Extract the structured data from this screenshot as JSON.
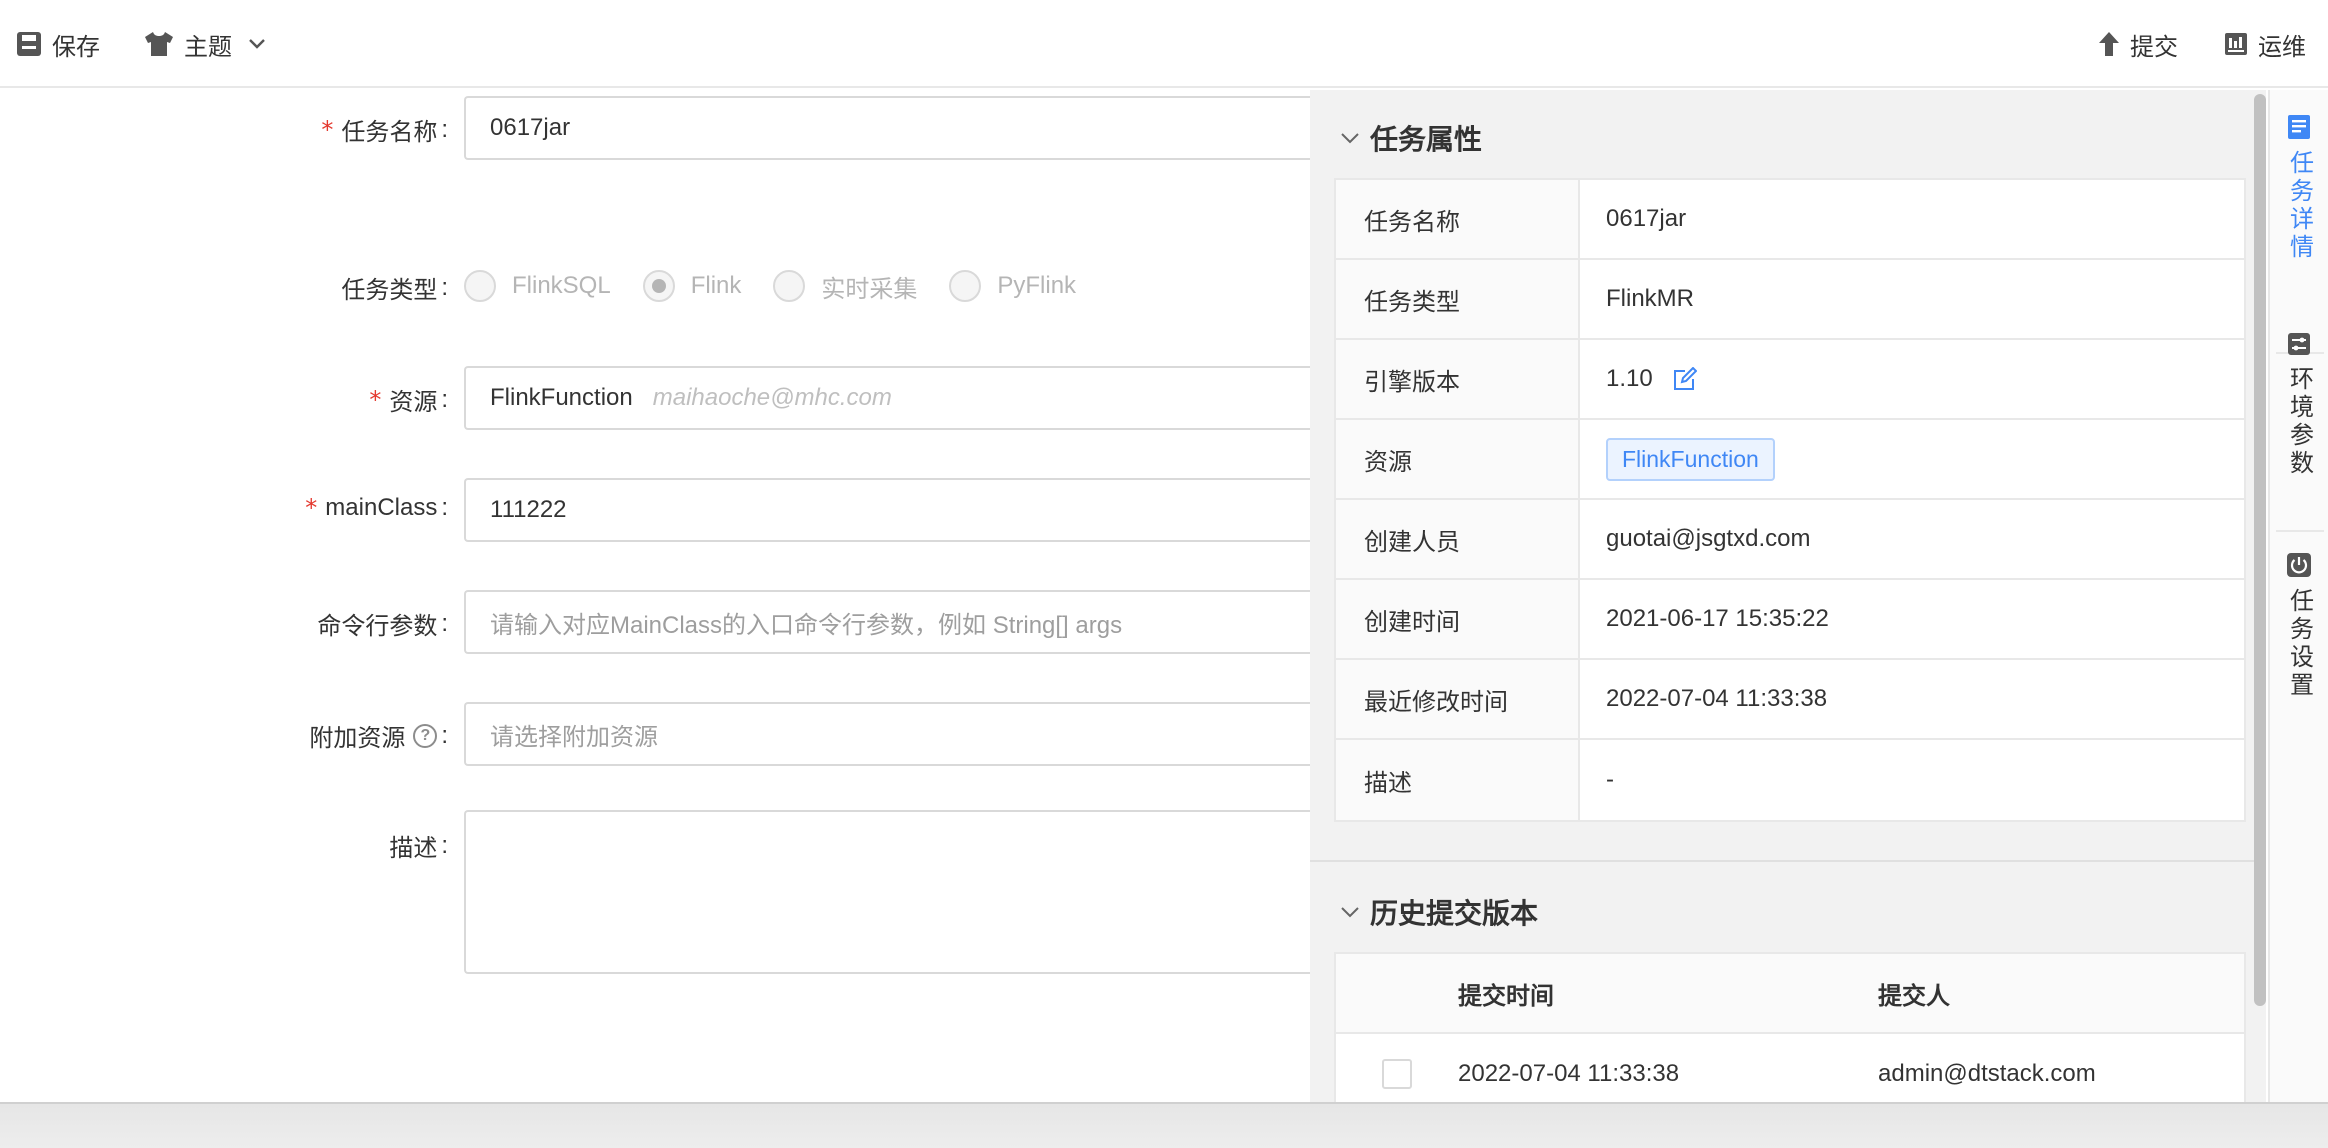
{
  "toolbar": {
    "save": "保存",
    "theme": "主题",
    "submit": "提交",
    "ops": "运维"
  },
  "form": {
    "task_name": {
      "label": "任务名称",
      "value": "0617jar"
    },
    "task_type": {
      "label": "任务类型",
      "options": [
        "FlinkSQL",
        "Flink",
        "实时采集",
        "PyFlink"
      ],
      "selected": "Flink"
    },
    "resource": {
      "label": "资源",
      "value": "FlinkFunction",
      "owner": "maihaoche@mhc.com"
    },
    "main_class": {
      "label": "mainClass",
      "value": "111222"
    },
    "cmd_args": {
      "label": "命令行参数",
      "placeholder": "请输入对应MainClass的入口命令行参数，例如 String[] args"
    },
    "extra_resource": {
      "label": "附加资源",
      "placeholder": "请选择附加资源"
    },
    "description": {
      "label": "描述",
      "value": ""
    }
  },
  "panel": {
    "props_title": "任务属性",
    "props": [
      {
        "key": "任务名称",
        "value": "0617jar"
      },
      {
        "key": "任务类型",
        "value": "FlinkMR"
      },
      {
        "key": "引擎版本",
        "value": "1.10"
      },
      {
        "key": "资源",
        "value": "FlinkFunction"
      },
      {
        "key": "创建人员",
        "value": "guotai@jsgtxd.com"
      },
      {
        "key": "创建时间",
        "value": "2021-06-17 15:35:22"
      },
      {
        "key": "最近修改时间",
        "value": "2022-07-04 11:33:38"
      },
      {
        "key": "描述",
        "value": "-"
      }
    ],
    "history_title": "历史提交版本",
    "history_columns": [
      "提交时间",
      "提交人"
    ],
    "history_rows": [
      {
        "time": "2022-07-04 11:33:38",
        "user": "admin@dtstack.com"
      }
    ]
  },
  "side_tabs": [
    {
      "label": "任务详情",
      "active": true
    },
    {
      "label": "环境参数",
      "active": false
    },
    {
      "label": "任务设置",
      "active": false
    }
  ],
  "colors": {
    "accent": "#3f87f5",
    "required": "#e4392f"
  }
}
